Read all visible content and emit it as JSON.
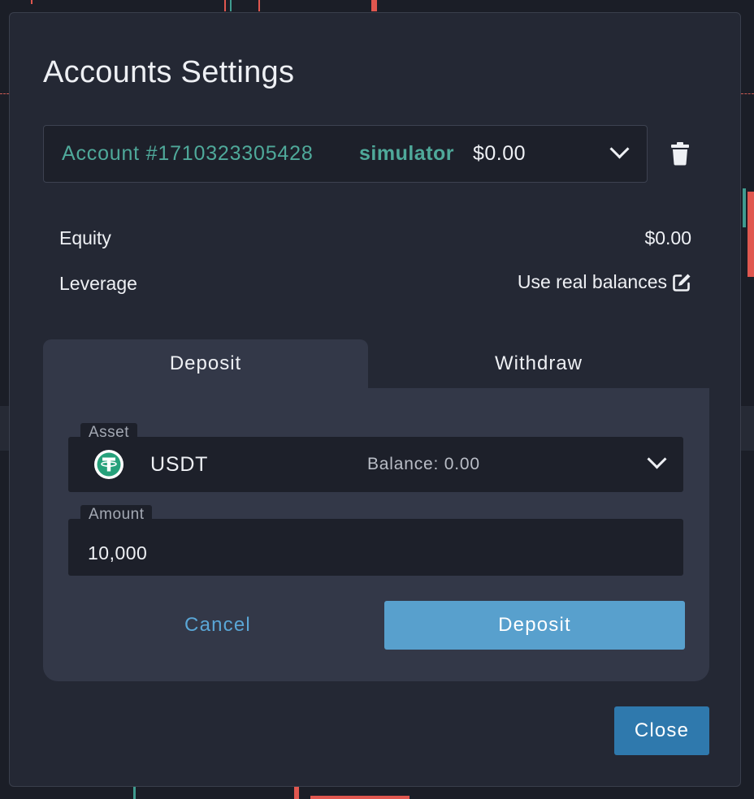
{
  "modal": {
    "title": "Accounts Settings"
  },
  "account": {
    "name": "Account #1710323305428",
    "type": "simulator",
    "balance": "$0.00"
  },
  "summary": {
    "equity_label": "Equity",
    "equity_value": "$0.00",
    "leverage_label": "Leverage",
    "leverage_link": "Use real balances"
  },
  "tabs": [
    {
      "label": "Deposit",
      "active": true
    },
    {
      "label": "Withdraw",
      "active": false
    }
  ],
  "form": {
    "asset_label": "Asset",
    "asset_value": "USDT",
    "asset_balance": "Balance: 0.00",
    "amount_label": "Amount",
    "amount_value": "10,000"
  },
  "buttons": {
    "cancel": "Cancel",
    "deposit": "Deposit",
    "close": "Close"
  },
  "colors": {
    "accent_green": "#4fa99a",
    "primary_blue": "#2f79ad",
    "deposit_blue": "#58a0cd",
    "link_blue": "#5aa6d6",
    "tether_green": "#26a17b"
  },
  "icons": {
    "delete": "trash-icon",
    "edit": "edit-icon",
    "dropdown": "chevron-down-icon",
    "asset": "usdt-icon"
  }
}
